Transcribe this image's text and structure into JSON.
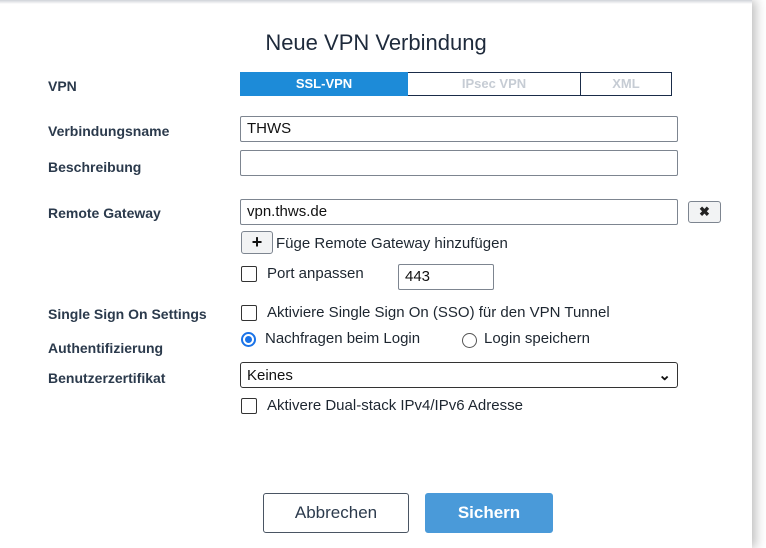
{
  "dialog": {
    "title": "Neue VPN Verbindung"
  },
  "labels": {
    "vpn": "VPN",
    "connection_name": "Verbindungsname",
    "description": "Beschreibung",
    "remote_gateway": "Remote Gateway",
    "sso_settings": "Single Sign On Settings",
    "authentication": "Authentifizierung",
    "user_certificate": "Benutzerzertifikat"
  },
  "vpn_type": {
    "options": [
      "SSL-VPN",
      "IPsec VPN",
      "XML"
    ],
    "selected": "SSL-VPN"
  },
  "fields": {
    "connection_name": "THWS",
    "description": "",
    "remote_gateway": "vpn.thws.de",
    "port": "443"
  },
  "remote_gateway_actions": {
    "remove_symbol": "✖",
    "add_symbol": "+",
    "add_label": "Füge Remote Gateway hinzufügen"
  },
  "port_option": {
    "label": "Port anpassen",
    "checked": false
  },
  "sso_option": {
    "label": "Aktiviere Single Sign On (SSO) für den VPN Tunnel",
    "checked": false
  },
  "authentication": {
    "options": [
      "Nachfragen beim Login",
      "Login speichern"
    ],
    "selected": "Nachfragen beim Login"
  },
  "certificate": {
    "selected": "Keines"
  },
  "dualstack_option": {
    "label": "Aktivere Dual-stack IPv4/IPv6 Adresse",
    "checked": false
  },
  "buttons": {
    "cancel": "Abbrechen",
    "save": "Sichern"
  },
  "colors": {
    "accent": "#1d8bd8",
    "save_button": "#4a9ad9",
    "radio_selected": "#1a73e8"
  },
  "icons": {
    "remove": "close-icon",
    "add": "plus-icon",
    "dropdown": "chevron-down-icon"
  }
}
